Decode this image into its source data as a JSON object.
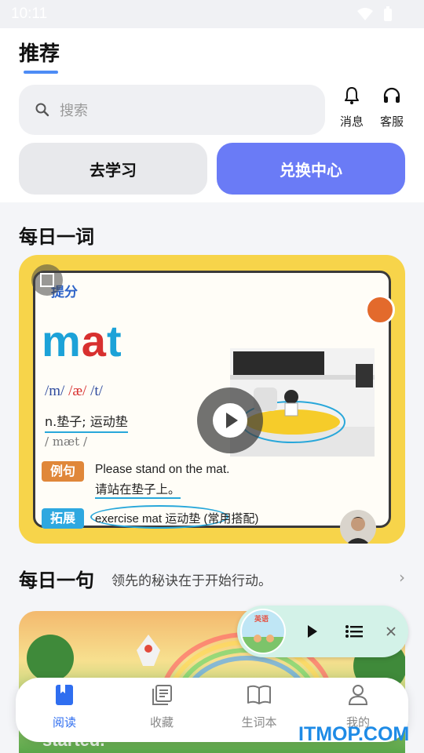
{
  "status_bar": {
    "time": "10:11"
  },
  "header": {
    "title": "推荐"
  },
  "search": {
    "placeholder": "搜索"
  },
  "top_actions": {
    "messages_label": "消息",
    "service_label": "客服"
  },
  "buttons": {
    "study_label": "去学习",
    "exchange_label": "兑换中心"
  },
  "daily_word": {
    "section_title": "每日一词",
    "tag": "提分",
    "word_part1": "m",
    "word_part2": "a",
    "word_part3": "t",
    "phonetic_1": "/m/",
    "phonetic_2": "/æ/",
    "phonetic_3": "/t/",
    "meaning": "n.垫子; 运动垫",
    "ipa": "/ mæt /",
    "example_chip": "例句",
    "example_en": "Please stand on the mat.",
    "example_zh": "请站在垫子上。",
    "extension_chip": "拓展",
    "extension_text": "exercise mat 运动垫 (常用搭配)"
  },
  "daily_sentence": {
    "section_title": "每日一句",
    "text": "领先的秘诀在于开始行动。"
  },
  "image_card": {
    "overlay_text": "started."
  },
  "mini_player": {
    "cover_title": "英语"
  },
  "bottom_nav": {
    "items": [
      {
        "label": "阅读",
        "active": true
      },
      {
        "label": "收藏",
        "active": false
      },
      {
        "label": "生词本",
        "active": false
      },
      {
        "label": "我的",
        "active": false
      }
    ]
  },
  "watermark": "ITMOP.COM",
  "colors": {
    "accent": "#6a7bf6",
    "nav_active": "#2f6ef0",
    "card_yellow": "#f7d44a",
    "player_bg": "#d3f2e8"
  }
}
